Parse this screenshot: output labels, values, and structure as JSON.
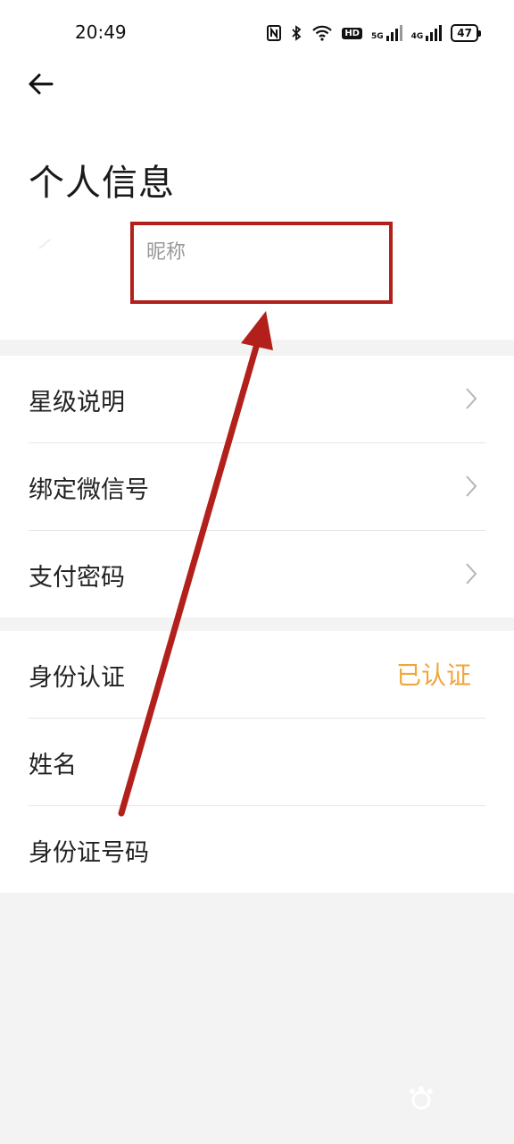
{
  "status_bar": {
    "time": "20:49",
    "icons": [
      "nfc-icon",
      "bluetooth-icon",
      "wifi-icon",
      "hd-icon",
      "signal-5g-icon",
      "signal-4g-icon",
      "battery-icon"
    ],
    "hd_label": "HD",
    "net1_label": "5G",
    "net2_label": "4G",
    "battery_level": "47"
  },
  "header": {
    "title": "个人信息",
    "nickname_placeholder": "昵称"
  },
  "section1": {
    "items": [
      {
        "label": "星级说明",
        "icon": "chevron-right-icon"
      },
      {
        "label": "绑定微信号",
        "icon": "chevron-right-icon"
      },
      {
        "label": "支付密码",
        "icon": "chevron-right-icon"
      }
    ]
  },
  "section2": {
    "items": [
      {
        "label": "身份认证",
        "value": "已认证"
      },
      {
        "label": "姓名",
        "value": ""
      },
      {
        "label": "身份证号码",
        "value": ""
      }
    ]
  },
  "colors": {
    "accent_verified": "#f0a63a",
    "annotation_red": "#b3201c",
    "background": "#f3f3f3"
  }
}
